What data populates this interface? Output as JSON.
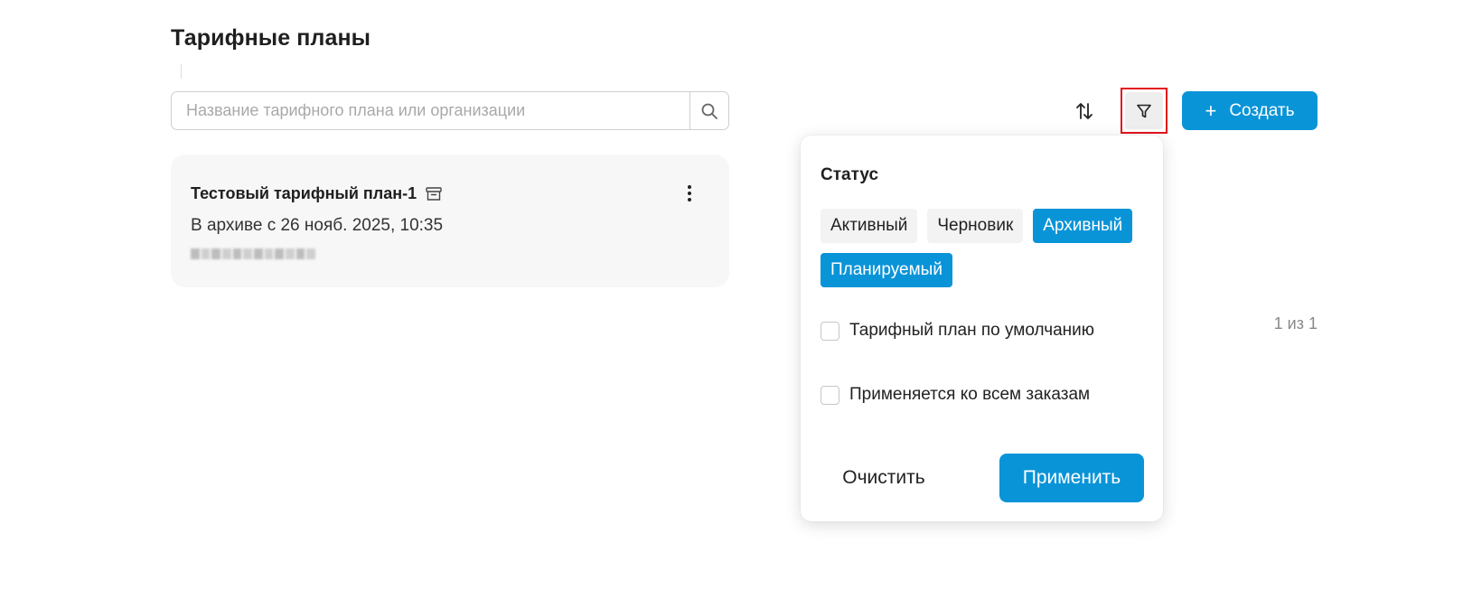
{
  "page": {
    "title": "Тарифные планы"
  },
  "search": {
    "placeholder": "Название тарифного плана или организации",
    "icon": "search-icon"
  },
  "toolbar": {
    "sort_icon": "sort-arrows-icon",
    "filter_icon": "filter-funnel-icon",
    "create_label": "Создать",
    "create_icon": "plus-icon"
  },
  "colors": {
    "accent": "#0a94d8",
    "highlight_border": "#e3141b",
    "card_bg": "#f7f7f7"
  },
  "plans": [
    {
      "name": "Тестовый тарифный план-1",
      "status_icon": "archive-icon",
      "subtitle": "В архиве с 26 нояб. 2025, 10:35",
      "redacted": true
    }
  ],
  "pagination": {
    "label": "1 из 1"
  },
  "filter_panel": {
    "status_title": "Статус",
    "statuses": [
      {
        "label": "Активный",
        "selected": false
      },
      {
        "label": "Черновик",
        "selected": false
      },
      {
        "label": "Архивный",
        "selected": true
      },
      {
        "label": "Планируемый",
        "selected": true
      }
    ],
    "checkboxes": [
      {
        "label": "Тарифный план по умолчанию",
        "checked": false
      },
      {
        "label": "Применяется ко всем заказам",
        "checked": false
      }
    ],
    "clear_label": "Очистить",
    "apply_label": "Применить"
  }
}
